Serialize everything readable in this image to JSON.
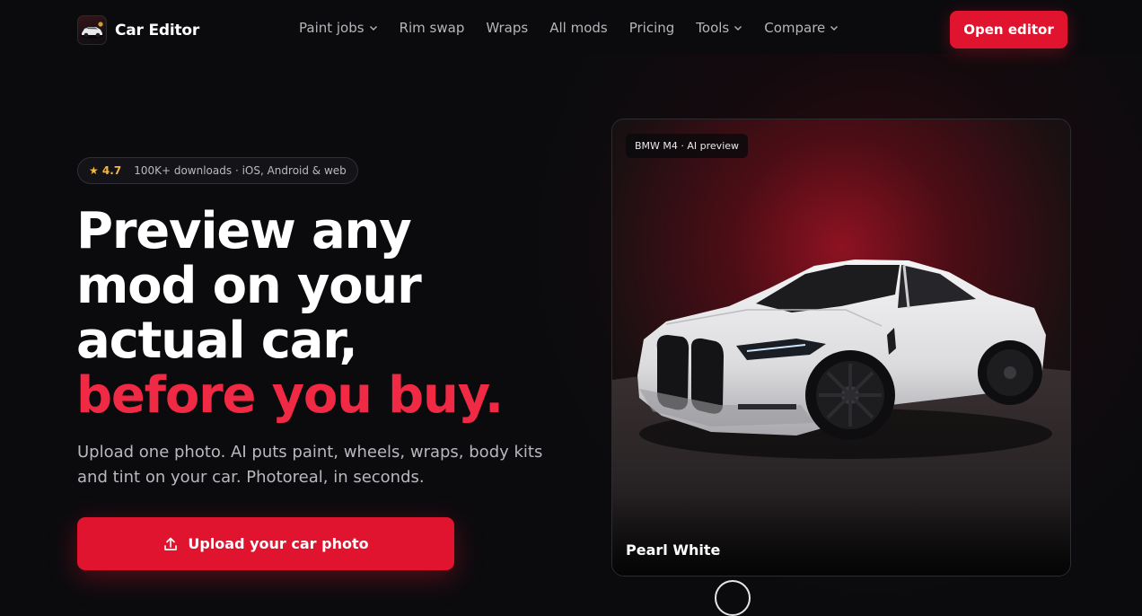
{
  "header": {
    "brand": "Car Editor",
    "nav": [
      {
        "label": "Paint jobs",
        "dropdown": true,
        "icon": "chevron-down-icon"
      },
      {
        "label": "Rim swap",
        "dropdown": false
      },
      {
        "label": "Wraps",
        "dropdown": false
      },
      {
        "label": "All mods",
        "dropdown": false
      },
      {
        "label": "Pricing",
        "dropdown": false
      },
      {
        "label": "Tools",
        "dropdown": true,
        "icon": "chevron-down-icon"
      },
      {
        "label": "Compare",
        "dropdown": true,
        "icon": "chevron-down-icon"
      }
    ],
    "cta_label": "Open editor"
  },
  "hero": {
    "rating": {
      "score": "★ 4.7",
      "meta": "100K+ downloads · iOS, Android & web"
    },
    "headline_line1": "Preview any",
    "headline_line2": "mod on your",
    "headline_line3": "actual car,",
    "headline_accent": "before you buy.",
    "subcopy_line1": "Upload one photo. AI puts paint, wheels, wraps, body kits",
    "subcopy_line2": "and tint on your car. Photoreal, in seconds.",
    "upload_label": "Upload your car photo",
    "upload_icon": "upload-icon"
  },
  "preview": {
    "tag": "BMW M4 · AI preview",
    "caption": "Pearl White"
  },
  "colors": {
    "background": "#0b0b0e",
    "accent": "#e0142f",
    "headline_accent": "#f02a44",
    "rating_star": "#f5b63a",
    "muted_text": "#b8b8be"
  }
}
